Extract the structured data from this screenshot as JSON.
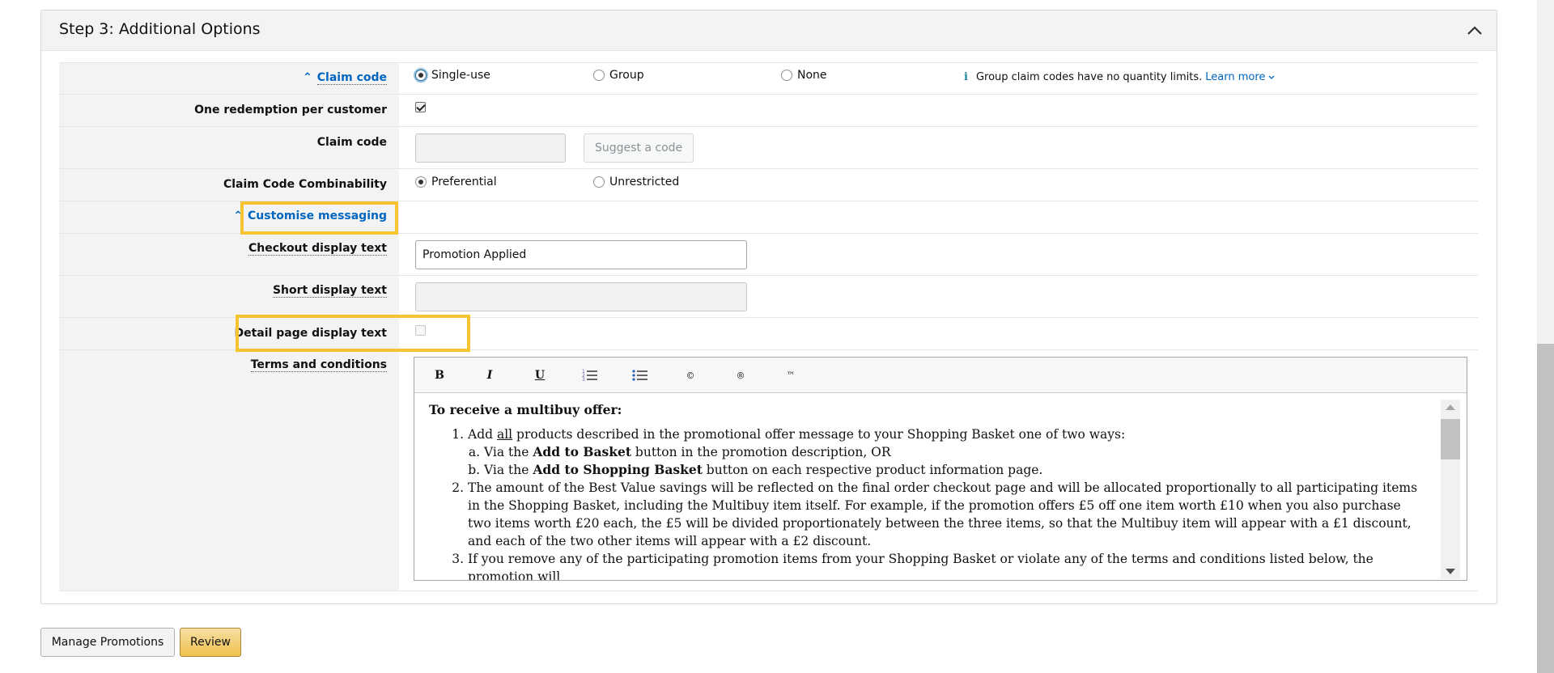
{
  "section": {
    "title": "Step 3: Additional Options"
  },
  "claim_code_type": {
    "label": "Claim code",
    "options": [
      "Single-use",
      "Group",
      "None"
    ],
    "selected": "Single-use",
    "info_text": "Group claim codes have no quantity limits.",
    "learn_more": "Learn more"
  },
  "one_redemption": {
    "label": "One redemption per customer",
    "checked": true
  },
  "claim_code_input": {
    "label": "Claim code",
    "value": "",
    "suggest_label": "Suggest a code"
  },
  "combinability": {
    "label": "Claim Code Combinability",
    "options": [
      "Preferential",
      "Unrestricted"
    ],
    "selected": "Preferential"
  },
  "customise_messaging": {
    "label": "Customise messaging"
  },
  "checkout_text": {
    "label": "Checkout display text",
    "value": "Promotion Applied"
  },
  "short_text": {
    "label": "Short display text",
    "value": ""
  },
  "detail_text": {
    "label": "Detail page display text",
    "checked": false
  },
  "terms": {
    "label": "Terms and conditions",
    "toolbar": {
      "bold": "B",
      "italic": "I",
      "underline": "U",
      "copyright": "©",
      "registered": "®",
      "trademark": "™"
    },
    "heading": "To receive a multibuy offer:",
    "item1_pre": "Add ",
    "item1_all": "all",
    "item1_post": " products described in the promotional offer message to your Shopping Basket one of two ways:",
    "sub_a_pre": "Via the ",
    "sub_a_bold": "Add to Basket",
    "sub_a_post": " button in the promotion description, OR",
    "sub_b_pre": "Via the ",
    "sub_b_bold": "Add to Shopping Basket",
    "sub_b_post": " button on each respective product information page.",
    "item2": "The amount of the Best Value savings will be reflected on the final order checkout page and will be allocated proportionally to all participating items in the Shopping Basket, including the Multibuy item itself. For example, if the promotion offers £5 off one item worth £10 when you also purchase two items worth £20 each, the £5 will be divided proportionately between the three items, so that the Multibuy item will appear with a £1 discount, and each of the two other items will appear with a £2 discount.",
    "item3": "If you remove any of the participating promotion items from your Shopping Basket or violate any of the terms and conditions listed below, the promotion will"
  },
  "actions": {
    "manage": "Manage Promotions",
    "review": "Review"
  },
  "colors": {
    "highlight": "#f7c431",
    "link": "#0066c0",
    "review_button": "#f0c14b"
  }
}
